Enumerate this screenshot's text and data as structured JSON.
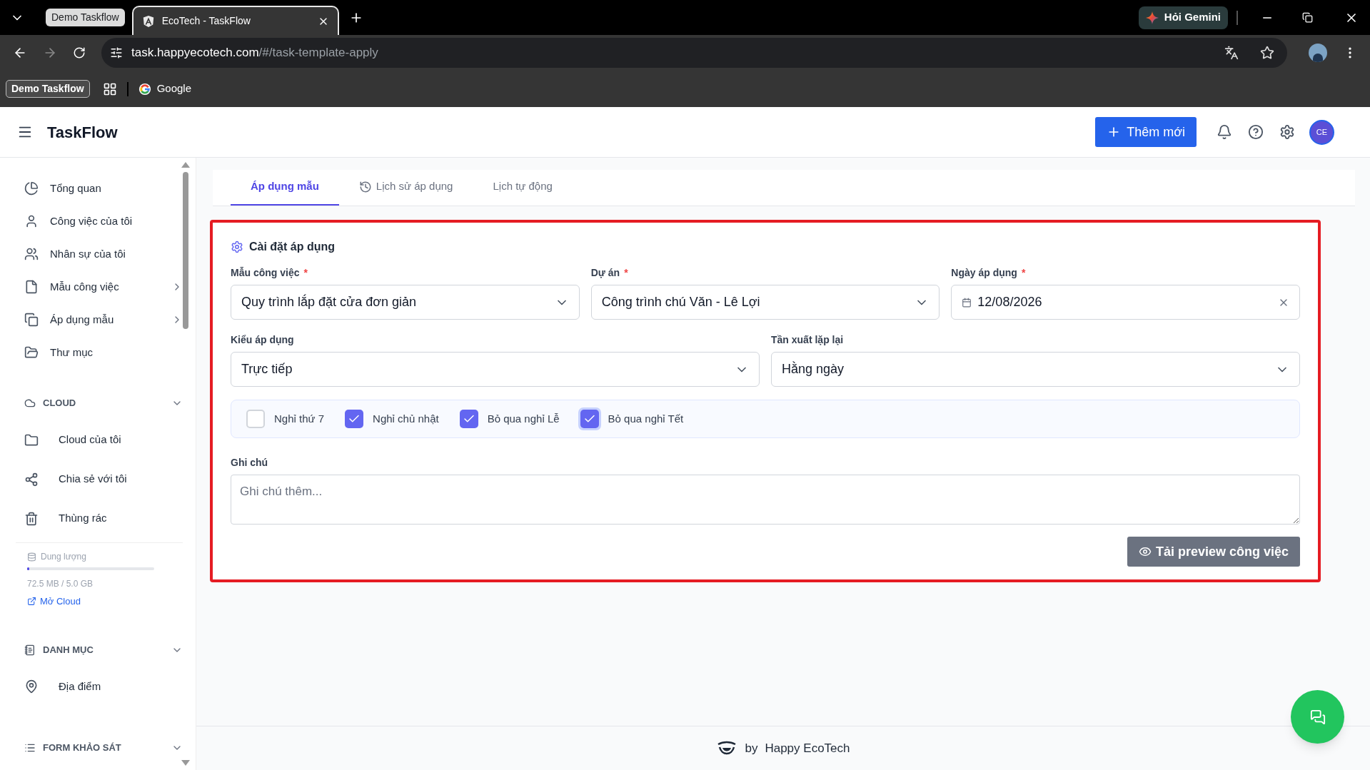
{
  "browser": {
    "tab_group": "Demo Taskflow",
    "tabs": [
      {
        "title": "EcoTech - TaskFlow",
        "selected": true
      }
    ],
    "gemini": "Hỏi Gemini",
    "url_host": "task.happyecotech.com",
    "url_path": "/#/task-template-apply",
    "bookmarks": [
      {
        "kind": "group",
        "label": "Demo Taskflow"
      },
      {
        "kind": "apps"
      },
      {
        "kind": "link",
        "label": "Google"
      }
    ]
  },
  "header": {
    "app_name": "TaskFlow",
    "add_button": "Thêm mới",
    "avatar": "CE"
  },
  "sidebar": {
    "items": [
      {
        "label": "Tổng quan",
        "has_submenu": false
      },
      {
        "label": "Công việc của tôi",
        "has_submenu": false
      },
      {
        "label": "Nhân sự của tôi",
        "has_submenu": false
      },
      {
        "label": "Mẫu công việc",
        "has_submenu": true
      },
      {
        "label": "Áp dụng mẫu",
        "has_submenu": true
      },
      {
        "label": "Thư mục",
        "has_submenu": false
      }
    ],
    "sections": [
      {
        "title": "CLOUD",
        "expanded": true,
        "items": [
          {
            "label": "Cloud của tôi"
          },
          {
            "label": "Chia sẻ với tôi"
          },
          {
            "label": "Thùng rác"
          }
        ],
        "storage": {
          "label": "Dung lượng",
          "level": 0.015,
          "reading": "72.5 MB / 5.0 GB",
          "link": "Mở Cloud"
        }
      },
      {
        "title": "DANH MỤC",
        "expanded": true,
        "items": [
          {
            "label": "Địa điểm"
          }
        ]
      },
      {
        "title": "FORM KHẢO SÁT",
        "expanded": true
      }
    ]
  },
  "tabs": [
    {
      "label": "Áp dụng mẫu",
      "selected": true
    },
    {
      "label": "Lịch sử áp dụng",
      "selected": false
    },
    {
      "label": "Lịch tự động",
      "selected": false
    }
  ],
  "form": {
    "highlighted": true,
    "title": "Cài đặt áp dụng",
    "required_mark": "*",
    "row_1": [
      {
        "kind": "select",
        "label": "Mẫu công việc",
        "required": true,
        "value": "Quy trình lắp đặt cửa đơn giản"
      },
      {
        "kind": "select",
        "label": "Dự án",
        "required": true,
        "value": "Công trình chú Văn - Lê Lợi"
      },
      {
        "kind": "date",
        "label": "Ngày áp dụng",
        "required": true,
        "value": "12/08/2026"
      }
    ],
    "row_2": [
      {
        "kind": "select",
        "label": "Kiểu áp dụng",
        "required": false,
        "value": "Trực tiếp"
      },
      {
        "kind": "select",
        "label": "Tần xuất lặp lại",
        "required": false,
        "value": "Hằng ngày"
      }
    ],
    "options": [
      {
        "label": "Nghỉ thứ 7",
        "checked": false,
        "focused": false
      },
      {
        "label": "Nghỉ chủ nhật",
        "checked": true,
        "focused": false
      },
      {
        "label": "Bỏ qua nghỉ Lễ",
        "checked": true,
        "focused": false
      },
      {
        "label": "Bỏ qua nghỉ Tết",
        "checked": true,
        "focused": true
      }
    ],
    "note": {
      "label": "Ghi chú",
      "placeholder": "Ghi chú thêm..."
    },
    "preview_button": "Tải preview công việc"
  },
  "footer": {
    "by": "by",
    "brand": "Happy EcoTech"
  }
}
